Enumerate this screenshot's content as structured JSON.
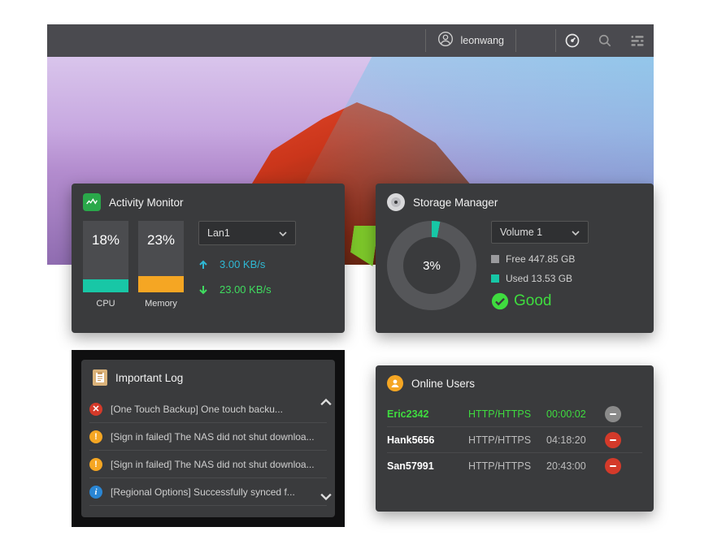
{
  "topbar": {
    "username": "leonwang"
  },
  "activity": {
    "title": "Activity Monitor",
    "cpu": {
      "pct": 18,
      "label": "CPU",
      "color": "#18c7a6"
    },
    "mem": {
      "pct": 23,
      "label": "Memory",
      "color": "#f5a623"
    },
    "interface": "Lan1",
    "up_rate": "3.00 KB/s",
    "down_rate": "23.00 KB/s"
  },
  "storage": {
    "title": "Storage Manager",
    "volume": "Volume 1",
    "used_pct": 3,
    "free": "Free 447.85 GB",
    "used": "Used 13.53 GB",
    "free_color": "#9a9a9d",
    "used_color": "#17c7a6",
    "status": "Good"
  },
  "log": {
    "title": "Important Log",
    "items": [
      {
        "kind": "err",
        "text": "[One Touch Backup] One touch backu..."
      },
      {
        "kind": "warn",
        "text": "[Sign in failed] The NAS did not shut downloa..."
      },
      {
        "kind": "warn",
        "text": "[Sign in failed] The NAS did not shut downloa..."
      },
      {
        "kind": "info",
        "text": "[Regional Options] Successfully synced f..."
      }
    ]
  },
  "online": {
    "title": "Online Users",
    "rows": [
      {
        "user": "Eric2342",
        "proto": "HTTP/HTTPS",
        "time": "00:00:02",
        "active": true,
        "action": "gray"
      },
      {
        "user": "Hank5656",
        "proto": "HTTP/HTTPS",
        "time": "04:18:20",
        "active": false,
        "action": "red"
      },
      {
        "user": "San57991",
        "proto": "HTTP/HTTPS",
        "time": "20:43:00",
        "active": false,
        "action": "red"
      }
    ]
  }
}
